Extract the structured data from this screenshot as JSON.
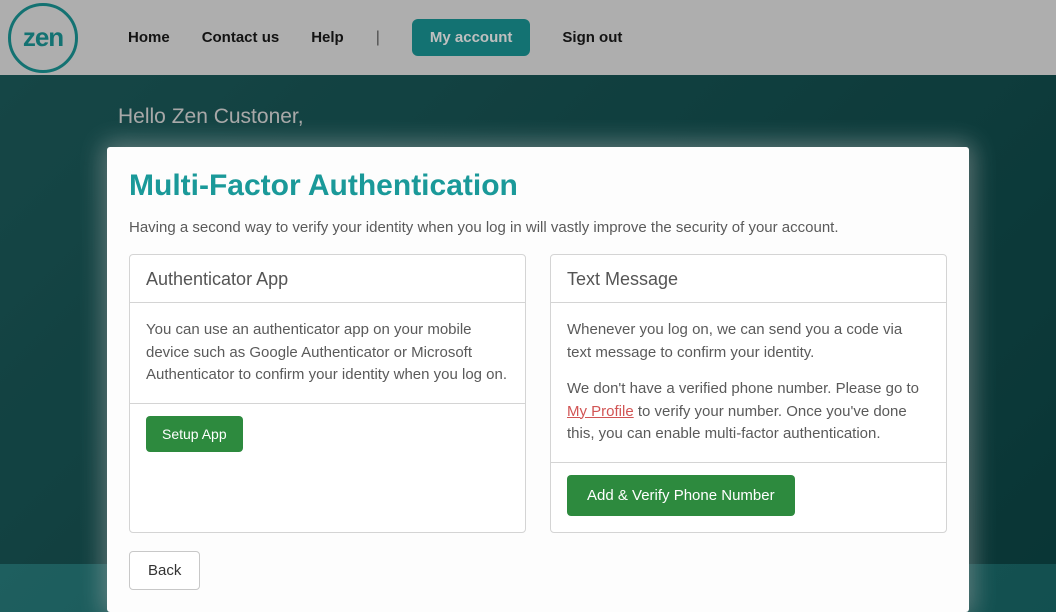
{
  "brand": {
    "logo_text": "zen"
  },
  "nav": {
    "home": "Home",
    "contact": "Contact us",
    "help": "Help",
    "my_account": "My account",
    "sign_out": "Sign out"
  },
  "greeting": "Hello Zen Custoner,",
  "modal": {
    "title": "Multi-Factor Authentication",
    "description": "Having a second way to verify your identity when you log in will vastly improve the security of your account.",
    "cards": {
      "authenticator": {
        "title": "Authenticator App",
        "body": "You can use an authenticator app on your mobile device such as Google Authenticator or Microsoft Authenticator to confirm your identity when you log on.",
        "button": "Setup App"
      },
      "text_message": {
        "title": "Text Message",
        "body1": "Whenever you log on, we can send you a code via text message to confirm your identity.",
        "body2_prefix": "We don't have a verified phone number. Please go to ",
        "body2_link": "My Profile",
        "body2_suffix": " to verify your number. Once you've done this, you can enable multi-factor authentication.",
        "button": "Add & Verify Phone Number"
      }
    },
    "back_button": "Back"
  }
}
